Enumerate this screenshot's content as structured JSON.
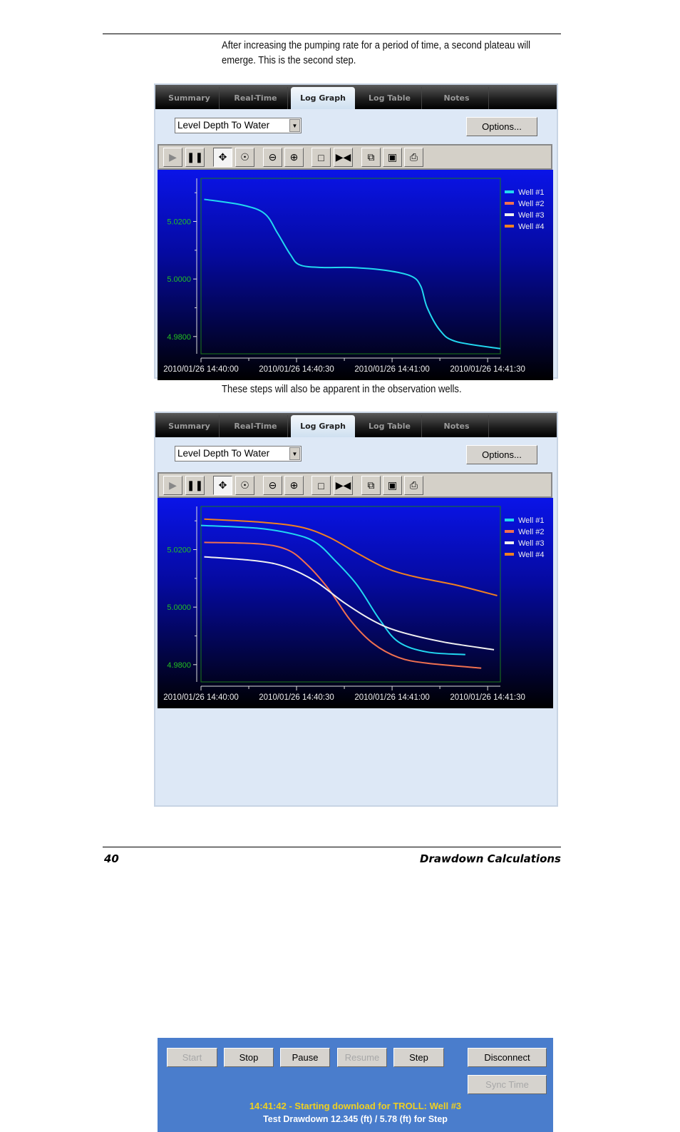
{
  "text": {
    "intro": "After increasing the pumping rate for a period of time, a second plateau will emerge. This is the second step.",
    "middle": "These steps will also be apparent in the observation wells."
  },
  "app": {
    "tabs": [
      "Summary",
      "Real-Time",
      "Log Graph",
      "Log Table",
      "Notes"
    ],
    "active_tab": "Log Graph",
    "parameter_select": "Level Depth To Water",
    "options_label": "Options...",
    "toolbar_icons": [
      "play-icon",
      "pause-icon",
      "pan-icon",
      "zoom-area-icon",
      "zoom-out-icon",
      "zoom-in-icon",
      "select-rect-icon",
      "fit-icon",
      "copy-icon",
      "save-icon",
      "print-icon"
    ],
    "buttons": {
      "start": "Start",
      "stop": "Stop",
      "pause": "Pause",
      "resume": "Resume",
      "step": "Step",
      "disconnect": "Disconnect",
      "sync_time": "Sync Time"
    },
    "status_line": "14:41:42 - Starting download for TROLL: Well #3",
    "drawdown_line": "Test Drawdown 12.345 (ft) / 5.78 (ft) for Step"
  },
  "colors": {
    "well1": "#22d8f0",
    "well2": "#f07050",
    "well3": "#f0f0f0",
    "well4": "#f08020",
    "tick_label_y": "#22c022",
    "panel": "#4a7dcc",
    "status": "#f0d020"
  },
  "chart_data": [
    {
      "type": "line",
      "xlim": [
        "2010/01/26 14:40:00",
        "2010/01/26 14:41:34"
      ],
      "ylim": [
        4.974,
        5.035
      ],
      "x_ticks": [
        "2010/01/26 14:40:00",
        "2010/01/26 14:40:30",
        "2010/01/26 14:41:00",
        "2010/01/26 14:41:30"
      ],
      "y_ticks": [
        "5.0200",
        "5.0000",
        "4.9800"
      ],
      "legend": [
        "Well #1",
        "Well #2",
        "Well #3",
        "Well #4"
      ],
      "legend_position": "right",
      "series": [
        {
          "name": "Well #1",
          "x": [
            "14:40:01",
            "14:40:13",
            "14:40:20",
            "14:40:24",
            "14:40:28",
            "14:40:31",
            "14:40:38",
            "14:40:47",
            "14:40:58",
            "14:41:06",
            "14:41:09",
            "14:41:11",
            "14:41:15",
            "14:41:20",
            "14:41:34"
          ],
          "y": [
            5.0277,
            5.0257,
            5.0227,
            5.016,
            5.0086,
            5.0049,
            5.004,
            5.004,
            5.003,
            5.001,
            4.9975,
            4.9901,
            4.9822,
            4.9783,
            4.9758
          ]
        }
      ]
    },
    {
      "type": "line",
      "xlim": [
        "2010/01/26 14:40:00",
        "2010/01/26 14:41:34"
      ],
      "ylim": [
        4.974,
        5.035
      ],
      "x_ticks": [
        "2010/01/26 14:40:00",
        "2010/01/26 14:40:30",
        "2010/01/26 14:41:00",
        "2010/01/26 14:41:30"
      ],
      "y_ticks": [
        "5.0200",
        "5.0000",
        "4.9800"
      ],
      "legend": [
        "Well #1",
        "Well #2",
        "Well #3",
        "Well #4"
      ],
      "legend_position": "right",
      "series": [
        {
          "name": "Well #1",
          "x": [
            "14:40:00",
            "14:40:18",
            "14:40:29",
            "14:40:36",
            "14:40:42",
            "14:40:49",
            "14:40:56",
            "14:41:02",
            "14:41:11",
            "14:41:23"
          ],
          "y": [
            5.0284,
            5.0274,
            5.0254,
            5.0225,
            5.0163,
            5.0077,
            4.9958,
            4.9879,
            4.9844,
            4.9835
          ]
        },
        {
          "name": "Well #2",
          "x": [
            "14:40:01",
            "14:40:18",
            "14:40:27",
            "14:40:33",
            "14:40:40",
            "14:40:47",
            "14:40:54",
            "14:41:02",
            "14:41:11",
            "14:41:28"
          ],
          "y": [
            5.0225,
            5.022,
            5.02,
            5.0151,
            5.0064,
            4.9953,
            4.9874,
            4.9825,
            4.9805,
            4.9788
          ]
        },
        {
          "name": "Well #3",
          "x": [
            "14:40:01",
            "14:40:18",
            "14:40:27",
            "14:40:36",
            "14:40:45",
            "14:40:54",
            "14:41:02",
            "14:41:16",
            "14:41:32"
          ],
          "y": [
            5.0175,
            5.016,
            5.0138,
            5.0089,
            5.0015,
            4.9953,
            4.9916,
            4.9879,
            4.9852
          ]
        },
        {
          "name": "Well #4",
          "x": [
            "14:40:01",
            "14:40:18",
            "14:40:31",
            "14:40:40",
            "14:40:49",
            "14:40:58",
            "14:41:07",
            "14:41:20",
            "14:41:33"
          ],
          "y": [
            5.0306,
            5.0296,
            5.0279,
            5.0244,
            5.0188,
            5.0136,
            5.0106,
            5.0077,
            5.004
          ]
        }
      ]
    }
  ],
  "footer": {
    "page_number": "40",
    "section": "Drawdown Calculations"
  }
}
